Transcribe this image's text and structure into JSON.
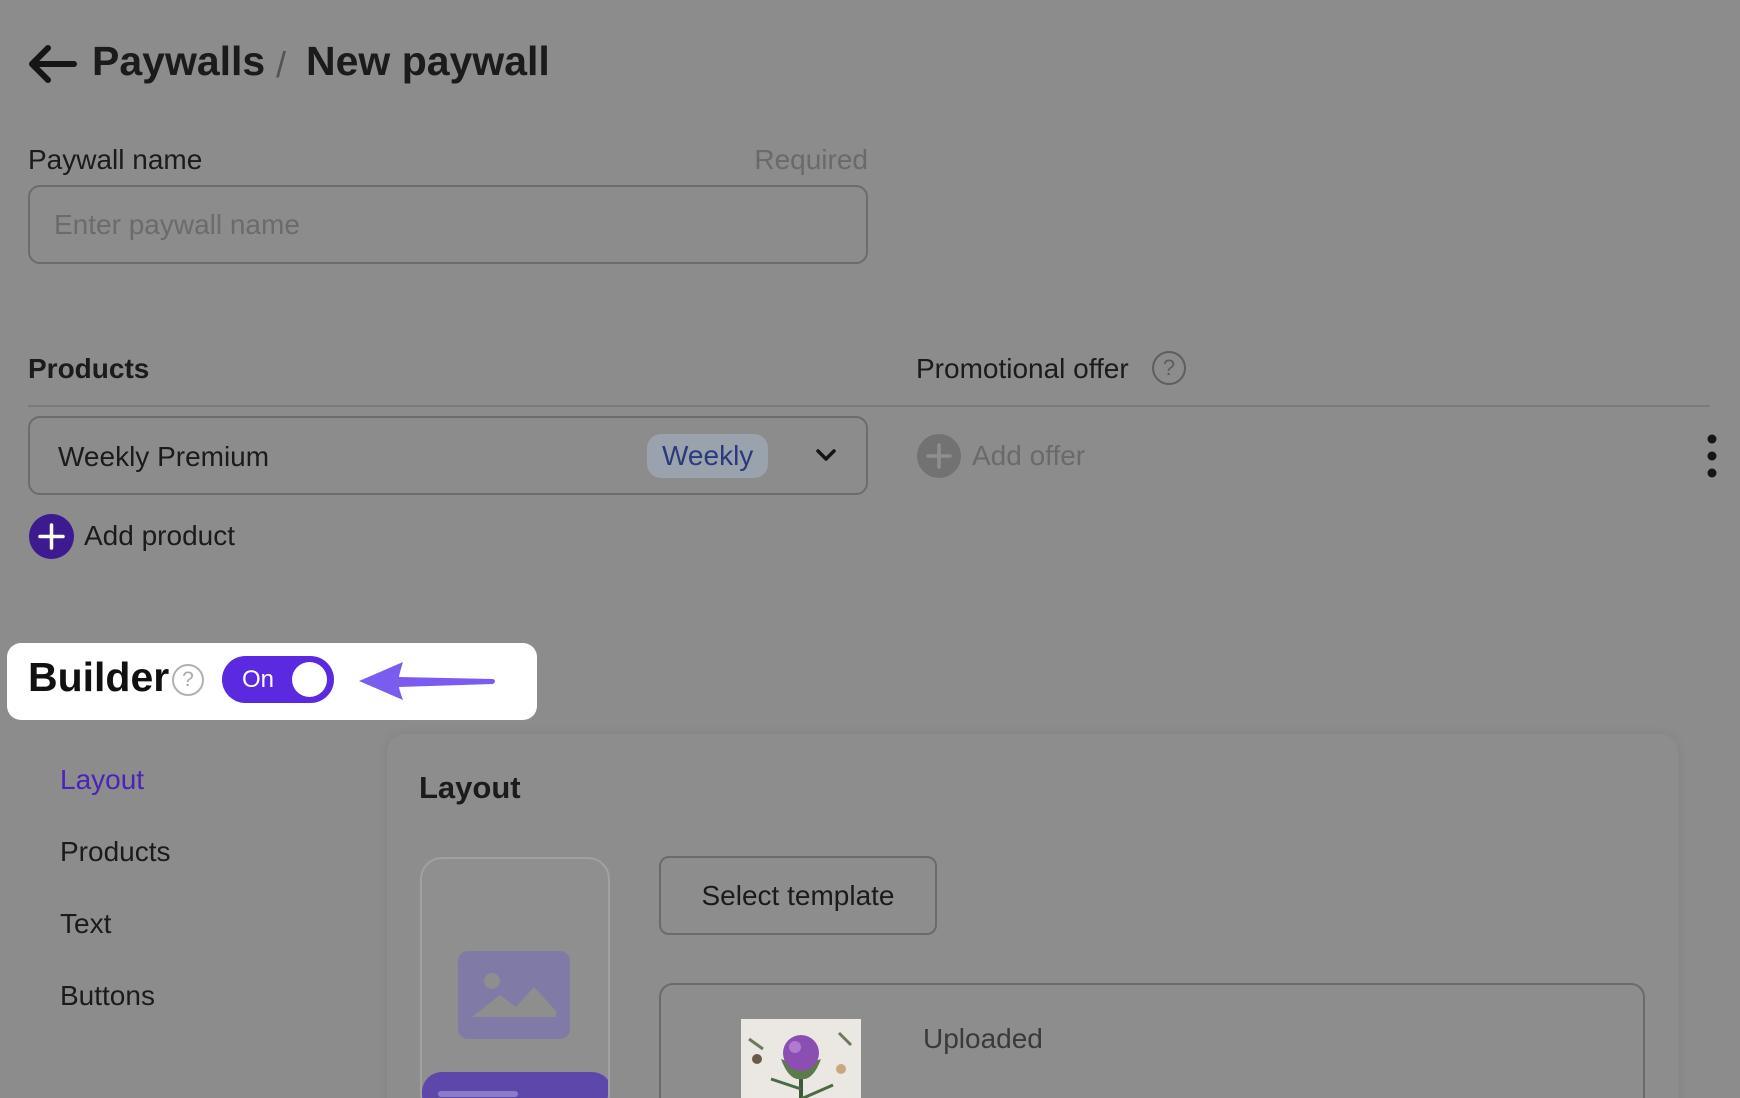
{
  "header": {
    "crumb_root": "Paywalls",
    "separator": "/",
    "crumb_current": "New paywall"
  },
  "paywall_name": {
    "label": "Paywall name",
    "required": "Required",
    "placeholder": "Enter paywall name",
    "value": ""
  },
  "products_section": {
    "heading": "Products",
    "promo_heading": "Promotional offer",
    "promo_help": "?",
    "items": [
      {
        "name": "Weekly Premium",
        "period_badge": "Weekly"
      }
    ],
    "add_offer_label": "Add offer",
    "add_product_label": "Add product"
  },
  "builder": {
    "title": "Builder",
    "help": "?",
    "toggle_label": "On",
    "toggle_on": true
  },
  "builder_nav": {
    "items": [
      "Layout",
      "Products",
      "Text",
      "Buttons"
    ],
    "active": "Layout"
  },
  "layout_panel": {
    "heading": "Layout",
    "select_template_label": "Select template",
    "uploaded_label": "Uploaded"
  },
  "colors": {
    "accent": "#5b2ae0",
    "nav_active": "#4b23b8",
    "overlay_background": "#8c8c8c",
    "pointer_arrow": "#7b5cf0"
  },
  "icons": {
    "back": "back-arrow-icon",
    "chevron": "chevron-down-icon",
    "add": "plus-circle-icon",
    "more": "more-vertical-icon",
    "help": "question-circle-icon",
    "image": "image-placeholder-icon"
  }
}
